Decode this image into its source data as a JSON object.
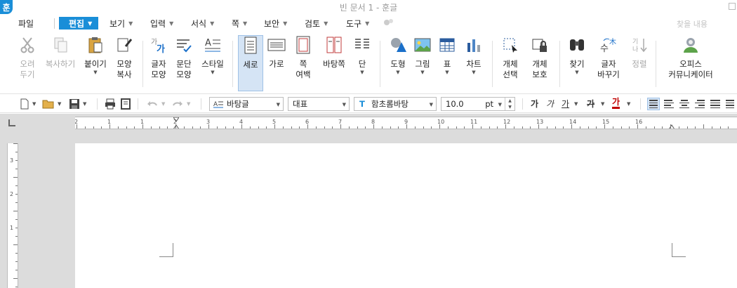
{
  "window": {
    "logo": "훈",
    "title": "빈 문서 1 - 훈글"
  },
  "menubar": {
    "items": [
      {
        "label": "파일",
        "has_caret": false,
        "active": false
      },
      {
        "label": "편집",
        "has_caret": true,
        "active": true
      },
      {
        "label": "보기",
        "has_caret": true,
        "active": false
      },
      {
        "label": "입력",
        "has_caret": true,
        "active": false
      },
      {
        "label": "서식",
        "has_caret": true,
        "active": false
      },
      {
        "label": "쪽",
        "has_caret": true,
        "active": false
      },
      {
        "label": "보안",
        "has_caret": true,
        "active": false
      },
      {
        "label": "검토",
        "has_caret": true,
        "active": false
      },
      {
        "label": "도구",
        "has_caret": true,
        "active": false
      }
    ],
    "search_placeholder": "찾을 내용"
  },
  "ribbon": {
    "cut": "오려\n두기",
    "copy": "복사하기",
    "paste": "붙이기",
    "format_copy": "모양\n복사",
    "char_shape": "글자\n모양",
    "para_shape": "문단\n모양",
    "style": "스타일",
    "vertical": "세로",
    "horizontal": "가로",
    "page_margin": "쪽\n여백",
    "master_page": "바탕쪽",
    "column": "단",
    "shape": "도형",
    "picture": "그림",
    "table": "표",
    "chart": "차트",
    "object_select": "개체\n선택",
    "object_protect": "개체\n보호",
    "find": "찾기",
    "replace": "글자\n바꾸기",
    "sort": "정렬",
    "office_comm": "오피스\n커뮤니케이터"
  },
  "toolbar": {
    "style_value": "바탕글",
    "lang_value": "대표",
    "font_value": "함초롬바탕",
    "size_value": "10.0",
    "size_unit": "pt",
    "bold_label": "가",
    "italic_label": "가",
    "underline_label": "가",
    "strike_label": "가",
    "color_label": "가",
    "accent": "#1a8ed8",
    "font_color": "#c00000"
  },
  "ruler": {
    "h_numbers": [
      "2",
      "1",
      "1",
      "2",
      "3",
      "4",
      "5",
      "6",
      "7",
      "8",
      "9",
      "10",
      "11",
      "12",
      "13",
      "14",
      "15",
      "16"
    ],
    "v_numbers": [
      "3",
      "2",
      "1"
    ]
  }
}
